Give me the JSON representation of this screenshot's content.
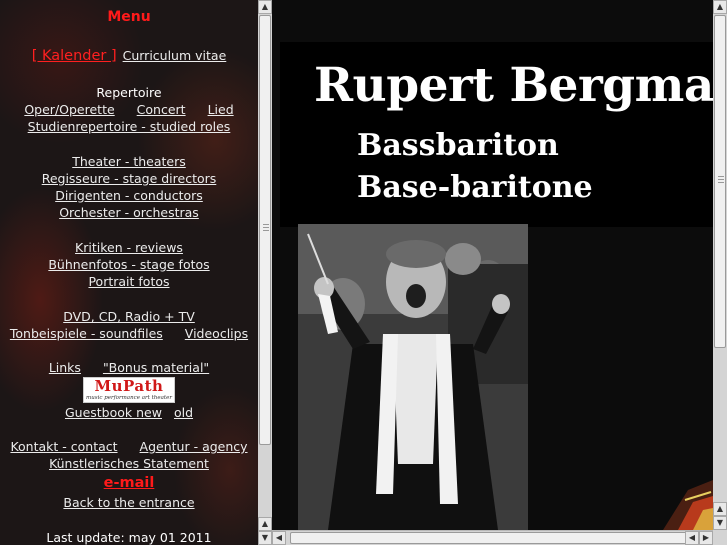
{
  "menu": {
    "title": "Menu",
    "kalender": "[ Kalender ]",
    "cv": "Curriculum vitae",
    "repertoire_heading": "Repertoire",
    "oper": "Oper/Operette",
    "concert": "Concert",
    "lied": "Lied",
    "studied": "Studienrepertoire - studied roles",
    "theater": "Theater - theaters",
    "regisseure": "Regisseure - stage directors",
    "dirigenten": "Dirigenten - conductors",
    "orchester": "Orchester - orchestras",
    "kritiken": "Kritiken - reviews",
    "buehnenfotos": "Bühnenfotos - stage fotos",
    "portrait": "Portrait fotos",
    "dvd": "DVD, CD, Radio + TV",
    "tonbeispiele": "Tonbeispiele - soundfiles",
    "videoclips": "Videoclips",
    "links": "Links",
    "bonus": "\"Bonus material\"",
    "logo_text": "MuPath",
    "logo_subtitle": "music performance art theater",
    "guestbook_new": "Guestbook new",
    "guestbook_old": "old",
    "kontakt": "Kontakt - contact",
    "agentur": "Agentur - agency",
    "statement": "Künstlerisches Statement",
    "email": "e-mail",
    "back": "Back to the entrance",
    "last_update": "Last update: may 01 2011"
  },
  "content": {
    "artist_name": "Rupert Bergmann",
    "voice_de": "Bassbariton",
    "voice_en": "Base-baritone"
  },
  "icons": {
    "up": "arrow-up-icon",
    "down": "arrow-down-icon",
    "left": "arrow-left-icon",
    "right": "arrow-right-icon"
  },
  "colors": {
    "menu_title": "#ff1a1a",
    "link": "#ececec",
    "background": "#000000"
  }
}
